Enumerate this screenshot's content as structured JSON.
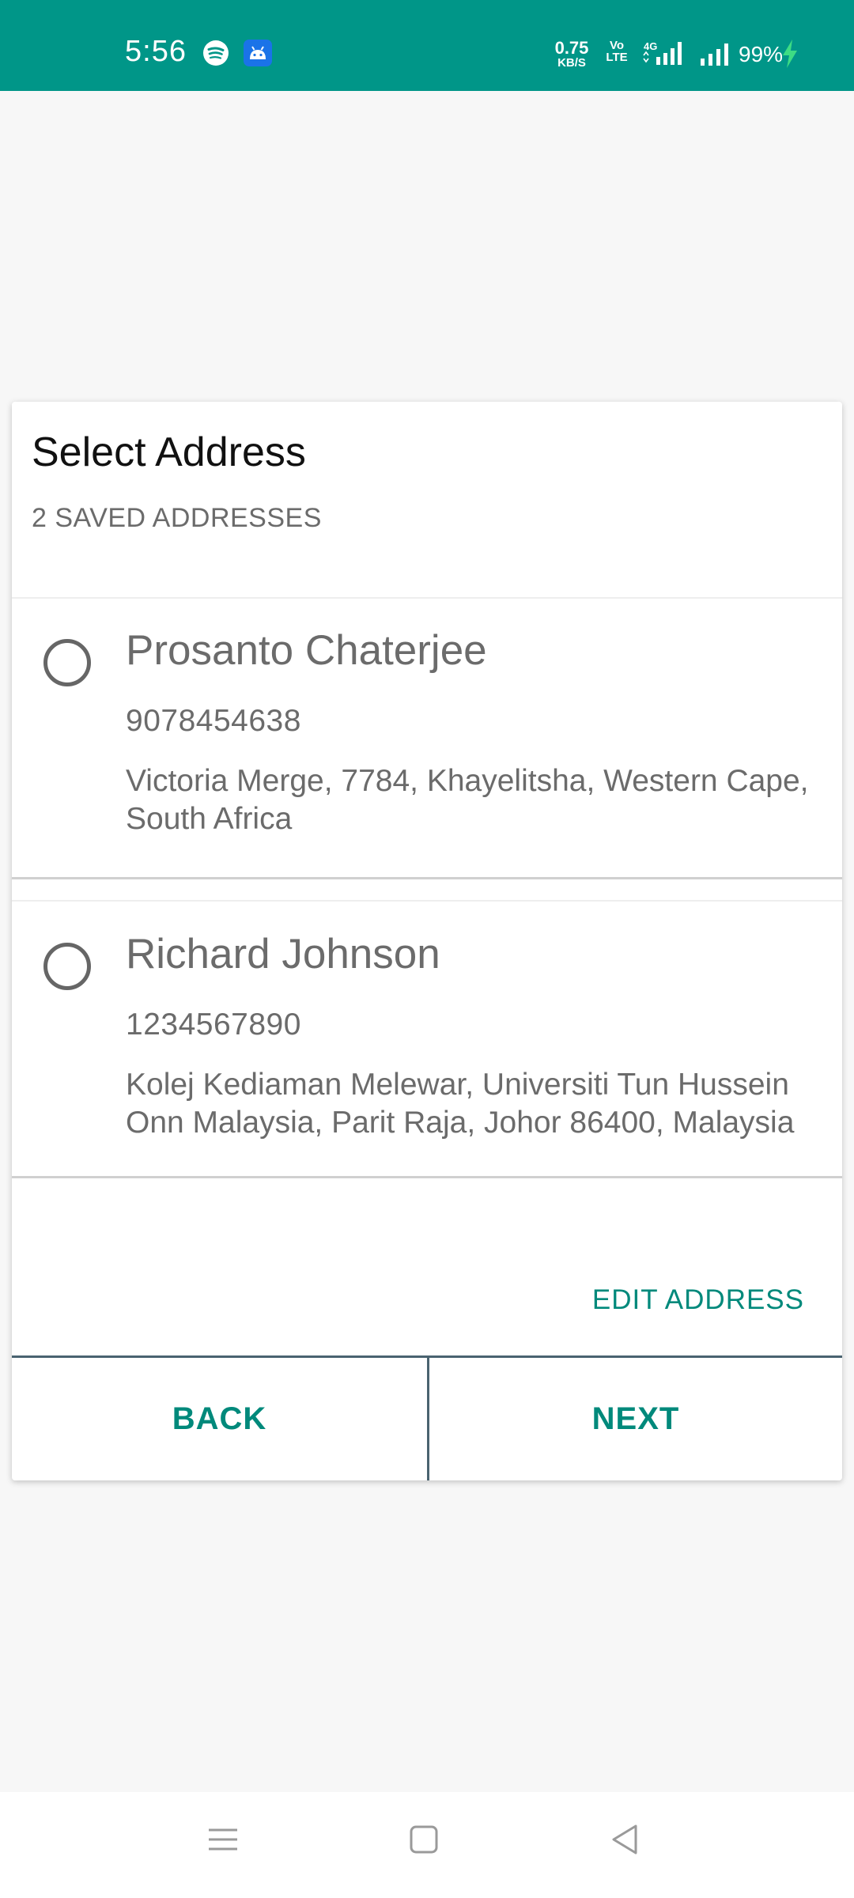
{
  "status_bar": {
    "time": "5:56",
    "net_speed_value": "0.75",
    "net_speed_unit": "KB/S",
    "volte_top": "Vo",
    "volte_bottom": "LTE",
    "network_type": "4G",
    "battery": "99%",
    "background_color": "#009688",
    "icons": [
      "spotify-icon",
      "android-icon",
      "lte-signal-icon",
      "signal-icon",
      "charging-bolt-icon"
    ]
  },
  "dialog": {
    "title": "Select Address",
    "subtitle": "2 SAVED ADDRESSES",
    "addresses": [
      {
        "name": "Prosanto Chaterjee",
        "phone": "9078454638",
        "address": "Victoria Merge, 7784, Khayelitsha, Western Cape,\nSouth Africa",
        "selected": false
      },
      {
        "name": "Richard Johnson",
        "phone": "1234567890",
        "address": "Kolej Kediaman Melewar, Universiti Tun Hussein\nOnn Malaysia, Parit Raja, Johor 86400, Malaysia",
        "selected": false
      }
    ],
    "edit_label": "EDIT ADDRESS",
    "back_label": "BACK",
    "next_label": "NEXT",
    "accent_color": "#00897b"
  },
  "nav_bar": {
    "icons": [
      "menu-icon",
      "home-icon",
      "back-icon"
    ]
  }
}
